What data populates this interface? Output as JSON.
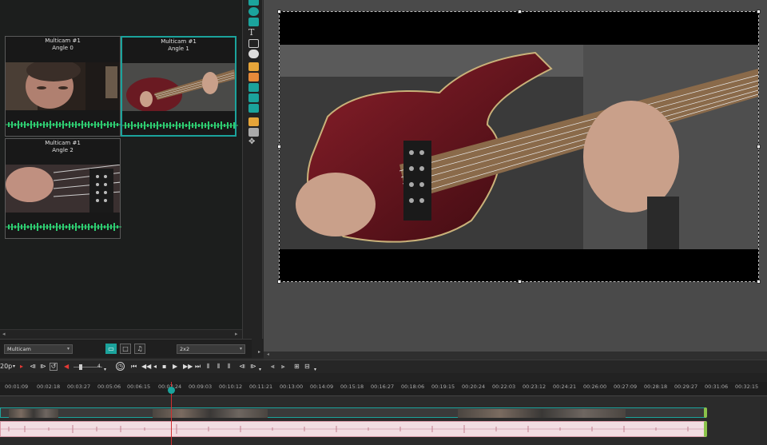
{
  "multicam": {
    "cells": [
      {
        "title": "Multicam #1",
        "angle": "Angle 0"
      },
      {
        "title": "Multicam #1",
        "angle": "Angle 1"
      },
      {
        "title": "Multicam #1",
        "angle": "Angle 2"
      }
    ],
    "source_select": "Multicam",
    "grid_select": "2x2",
    "view_buttons": [
      "monitor-icon",
      "screen-icon",
      "music-note-icon"
    ]
  },
  "transport": {
    "frame_rate": "20p",
    "volume_value": "4"
  },
  "ruler": {
    "labels": [
      "00:01:09",
      "00:02:18",
      "00:03:27",
      "00:05:06",
      "00:06:15",
      "00:07:24",
      "00:09:03",
      "00:10:12",
      "00:11:21",
      "00:13:00",
      "00:14:09",
      "00:15:18",
      "00:16:27",
      "00:18:06",
      "00:19:15",
      "00:20:24",
      "00:22:03",
      "00:23:12",
      "00:24:21",
      "00:26:00",
      "00:27:09",
      "00:28:18",
      "00:29:27",
      "00:31:06",
      "00:32:15"
    ]
  },
  "colors": {
    "accent": "#1ba39c",
    "waveform": "#2ecc71",
    "audio_track": "#f2dde2",
    "playhead": "#d32f2f"
  }
}
